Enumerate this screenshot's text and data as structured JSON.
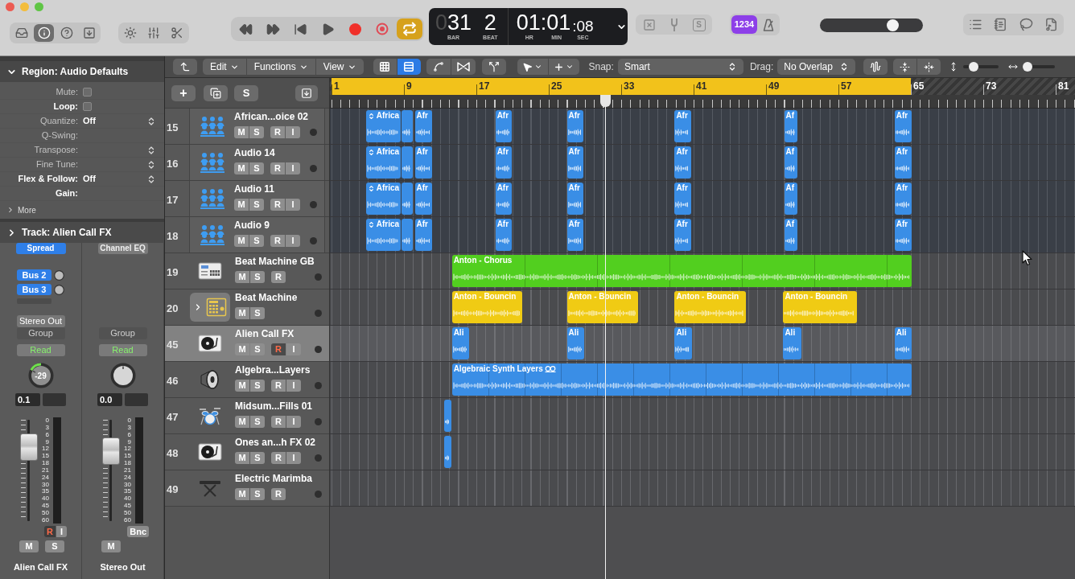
{
  "toolbar": {
    "view_buttons": [
      {
        "kind": "library",
        "selected": false
      },
      {
        "kind": "inspector",
        "selected": true
      },
      {
        "kind": "quick-help",
        "selected": false
      },
      {
        "kind": "toolbar",
        "selected": false
      }
    ],
    "transport": [
      {
        "kind": "rewind",
        "selected": false
      },
      {
        "kind": "forward",
        "selected": false
      },
      {
        "kind": "go-to-start",
        "selected": false
      },
      {
        "kind": "play",
        "selected": false
      },
      {
        "kind": "record",
        "selected": false
      },
      {
        "kind": "replace",
        "selected": false
      },
      {
        "kind": "cycle",
        "selected": true
      }
    ],
    "lcd": {
      "bar_lead": "0",
      "bar": "31",
      "beat": "2",
      "time": "01:01",
      "seconds": ":08",
      "captions": [
        "BAR",
        "BEAT",
        "HR",
        "MIN",
        "SEC"
      ]
    },
    "solo_label": "S",
    "count_in": {
      "label": "1234",
      "selected": true
    },
    "metronome": {
      "selected": false
    },
    "master_volume": {
      "level": 0.7
    }
  },
  "arrange_toolbar": {
    "menus": [
      "Edit",
      "Functions",
      "View"
    ],
    "view_modes": [
      {
        "kind": "grid",
        "selected": false
      },
      {
        "kind": "tracks",
        "selected": true
      }
    ],
    "snap": {
      "label": "Snap:",
      "value": "Smart"
    },
    "drag": {
      "label": "Drag:",
      "value": "No Overlap"
    },
    "vertical_zoom": {
      "level": 0.3
    },
    "horizontal_zoom": {
      "level": 0.15
    }
  },
  "track_tools": {
    "add": "+",
    "solo": "S"
  },
  "inspector": {
    "region": {
      "title": "Region: Audio Defaults",
      "expanded": true,
      "rows": [
        {
          "label": "Mute:",
          "kind": "checkbox",
          "checked": false,
          "highlighted": false
        },
        {
          "label": "Loop:",
          "kind": "checkbox",
          "checked": false,
          "highlighted": true
        },
        {
          "label": "Quantize:",
          "kind": "select",
          "value": "Off",
          "highlighted": false
        },
        {
          "label": "Q-Swing:",
          "kind": "blank",
          "highlighted": false
        },
        {
          "label": "Transpose:",
          "kind": "select",
          "highlighted": false
        },
        {
          "label": "Fine Tune:",
          "kind": "select",
          "highlighted": false
        },
        {
          "label": "Flex & Follow:",
          "kind": "select",
          "value": "Off",
          "highlighted": true
        },
        {
          "label": "Gain:",
          "kind": "blank",
          "highlighted": true
        }
      ]
    },
    "more": {
      "label": "More",
      "expanded": false
    },
    "track": {
      "title": "Track: Alien Call FX",
      "expanded": false
    },
    "strips": [
      {
        "slots": [
          {
            "label": "Spread",
            "kind": "instrument"
          }
        ],
        "sends": [
          {
            "label": "Bus 2"
          },
          {
            "label": "Bus 3"
          }
        ],
        "output": "Stereo Out",
        "group": "Group",
        "automation": "Read",
        "pan": "-29",
        "volume": "0.1",
        "fader": {
          "level": 0.72
        },
        "scale": [
          "0",
          "3",
          "6",
          "9",
          "12",
          "15",
          "18",
          "21",
          "24",
          "30",
          "35",
          "40",
          "45",
          "50",
          "60"
        ],
        "small_buttons": [
          {
            "kind": "record",
            "label": "R",
            "on": true
          },
          {
            "kind": "input",
            "label": "I",
            "on": false
          }
        ],
        "buttons": [
          {
            "kind": "mute",
            "label": "M",
            "on": false
          },
          {
            "kind": "solo",
            "label": "S",
            "on": false
          }
        ],
        "name": "Alien Call FX"
      },
      {
        "slots": [
          {
            "label": "Channel EQ",
            "kind": "effect"
          }
        ],
        "group": "Group",
        "automation": "Read",
        "volume": "0.0",
        "fader": {
          "level": 0.68
        },
        "scale": [
          "0",
          "3",
          "6",
          "9",
          "12",
          "15",
          "18",
          "21",
          "24",
          "30",
          "35",
          "40",
          "45",
          "50",
          "60"
        ],
        "small_buttons": [
          {
            "kind": "bounce",
            "label": "Bnc",
            "on": false
          }
        ],
        "buttons": [
          {
            "kind": "mute",
            "label": "M",
            "on": false
          }
        ],
        "name": "Stereo Out"
      }
    ]
  },
  "ruler": {
    "marks": [
      "1",
      "9",
      "17",
      "25",
      "33",
      "41",
      "49",
      "57",
      "65",
      "73",
      "81"
    ]
  },
  "tracks": [
    {
      "kind": "group",
      "children": [
        {
          "number": "15",
          "name": "African...oice 02",
          "kind": "vocal",
          "selected": false,
          "color": "#3a8ee6",
          "buttons": [
            {
              "kind": "mute",
              "label": "M",
              "on": false
            },
            {
              "kind": "solo",
              "label": "S",
              "on": false
            },
            {
              "kind": "record",
              "label": "R",
              "on": false
            },
            {
              "kind": "input",
              "label": "I",
              "on": false
            }
          ],
          "regions": [
            {
              "kind": "take",
              "name": "Africa"
            },
            {
              "kind": "audio"
            },
            {
              "kind": "audio",
              "name": "Afr"
            },
            {
              "kind": "audio",
              "name": "Afr"
            },
            {
              "kind": "audio",
              "name": "Afr"
            },
            {
              "kind": "audio",
              "name": "Afr"
            },
            {
              "kind": "audio",
              "name": "Af"
            },
            {
              "kind": "audio",
              "name": "Afr"
            }
          ]
        },
        {
          "number": "16",
          "name": "Audio 14",
          "kind": "vocal",
          "selected": false,
          "color": "#3a8ee6",
          "buttons": [
            {
              "kind": "mute",
              "label": "M",
              "on": false
            },
            {
              "kind": "solo",
              "label": "S",
              "on": false
            },
            {
              "kind": "record",
              "label": "R",
              "on": false
            },
            {
              "kind": "input",
              "label": "I",
              "on": false
            }
          ],
          "regions": [
            {
              "kind": "take",
              "name": "Africa"
            },
            {
              "kind": "audio"
            },
            {
              "kind": "audio",
              "name": "Afr"
            },
            {
              "kind": "audio",
              "name": "Afr"
            },
            {
              "kind": "audio",
              "name": "Afr"
            },
            {
              "kind": "audio",
              "name": "Afr"
            },
            {
              "kind": "audio",
              "name": "Af"
            },
            {
              "kind": "audio",
              "name": "Afr"
            }
          ]
        },
        {
          "number": "17",
          "name": "Audio 11",
          "kind": "vocal",
          "selected": false,
          "color": "#3a8ee6",
          "buttons": [
            {
              "kind": "mute",
              "label": "M",
              "on": false
            },
            {
              "kind": "solo",
              "label": "S",
              "on": false
            },
            {
              "kind": "record",
              "label": "R",
              "on": false
            },
            {
              "kind": "input",
              "label": "I",
              "on": false
            }
          ],
          "regions": [
            {
              "kind": "take",
              "name": "Africa"
            },
            {
              "kind": "audio"
            },
            {
              "kind": "audio",
              "name": "Afr"
            },
            {
              "kind": "audio",
              "name": "Afr"
            },
            {
              "kind": "audio",
              "name": "Afr"
            },
            {
              "kind": "audio",
              "name": "Afr"
            },
            {
              "kind": "audio",
              "name": "Af"
            },
            {
              "kind": "audio",
              "name": "Afr"
            }
          ]
        },
        {
          "number": "18",
          "name": "Audio 9",
          "kind": "vocal",
          "selected": false,
          "color": "#3a8ee6",
          "buttons": [
            {
              "kind": "mute",
              "label": "M",
              "on": false
            },
            {
              "kind": "solo",
              "label": "S",
              "on": false
            },
            {
              "kind": "record",
              "label": "R",
              "on": false
            },
            {
              "kind": "input",
              "label": "I",
              "on": false
            }
          ],
          "regions": [
            {
              "kind": "take",
              "name": "Africa"
            },
            {
              "kind": "audio"
            },
            {
              "kind": "audio",
              "name": "Afr"
            },
            {
              "kind": "audio",
              "name": "Afr"
            },
            {
              "kind": "audio",
              "name": "Afr"
            },
            {
              "kind": "audio",
              "name": "Afr"
            },
            {
              "kind": "audio",
              "name": "Af"
            },
            {
              "kind": "audio",
              "name": "Afr"
            }
          ]
        }
      ]
    },
    {
      "number": "19",
      "name": "Beat Machine GB",
      "kind": "drum-machine",
      "selected": false,
      "color": "#52cf1f",
      "buttons": [
        {
          "kind": "mute",
          "label": "M",
          "on": false
        },
        {
          "kind": "solo",
          "label": "S",
          "on": false
        },
        {
          "kind": "record",
          "label": "R",
          "on": false
        }
      ],
      "regions": [
        {
          "kind": "pattern",
          "name": "Anton - Chorus"
        }
      ]
    },
    {
      "number": "20",
      "name": "Beat Machine",
      "kind": "stack",
      "expanded": false,
      "selected": false,
      "color": "#f0cb14",
      "buttons": [
        {
          "kind": "mute",
          "label": "M",
          "on": false
        },
        {
          "kind": "solo",
          "label": "S",
          "on": false
        }
      ],
      "regions": [
        {
          "kind": "audio",
          "name": "Anton - Bouncin"
        },
        {
          "kind": "audio",
          "name": "Anton - Bouncin"
        },
        {
          "kind": "audio",
          "name": "Anton - Bouncin"
        },
        {
          "kind": "audio",
          "name": "Anton - Bouncin"
        }
      ]
    },
    {
      "number": "45",
      "name": "Alien Call FX",
      "kind": "sfx",
      "selected": true,
      "color": "#3a8ee6",
      "buttons": [
        {
          "kind": "mute",
          "label": "M",
          "on": false
        },
        {
          "kind": "solo",
          "label": "S",
          "on": false
        },
        {
          "kind": "record",
          "label": "R",
          "on": true
        },
        {
          "kind": "input",
          "label": "I",
          "on": false
        }
      ],
      "regions": [
        {
          "kind": "audio",
          "name": "Ali"
        },
        {
          "kind": "audio",
          "name": "Ali"
        },
        {
          "kind": "audio",
          "name": "Ali"
        },
        {
          "kind": "audio",
          "name": "Ali"
        },
        {
          "kind": "audio",
          "name": "Ali"
        }
      ]
    },
    {
      "number": "46",
      "name": "Algebra...Layers",
      "kind": "synth",
      "selected": false,
      "color": "#3a8ee6",
      "buttons": [
        {
          "kind": "mute",
          "label": "M",
          "on": false
        },
        {
          "kind": "solo",
          "label": "S",
          "on": false
        },
        {
          "kind": "record",
          "label": "R",
          "on": false
        },
        {
          "kind": "input",
          "label": "I",
          "on": false
        }
      ],
      "regions": [
        {
          "kind": "loop",
          "name": "Algebraic Synth Layers"
        }
      ]
    },
    {
      "number": "47",
      "name": "Midsum...Fills 01",
      "kind": "drummer",
      "selected": false,
      "color": "#3a8ee6",
      "buttons": [
        {
          "kind": "mute",
          "label": "M",
          "on": false
        },
        {
          "kind": "solo",
          "label": "S",
          "on": false
        },
        {
          "kind": "record",
          "label": "R",
          "on": false
        },
        {
          "kind": "input",
          "label": "I",
          "on": false
        }
      ],
      "regions": [
        {
          "kind": "audio"
        }
      ]
    },
    {
      "number": "48",
      "name": "Ones an...h FX 02",
      "kind": "sfx",
      "selected": false,
      "color": "#3a8ee6",
      "buttons": [
        {
          "kind": "mute",
          "label": "M",
          "on": false
        },
        {
          "kind": "solo",
          "label": "S",
          "on": false
        },
        {
          "kind": "record",
          "label": "R",
          "on": false
        },
        {
          "kind": "input",
          "label": "I",
          "on": false
        }
      ],
      "regions": [
        {
          "kind": "audio"
        }
      ]
    },
    {
      "number": "49",
      "name": "Electric Marimba",
      "kind": "keys",
      "selected": false,
      "buttons": [
        {
          "kind": "mute",
          "label": "M",
          "on": false
        },
        {
          "kind": "solo",
          "label": "S",
          "on": false
        },
        {
          "kind": "record",
          "label": "R",
          "on": false
        }
      ]
    }
  ]
}
